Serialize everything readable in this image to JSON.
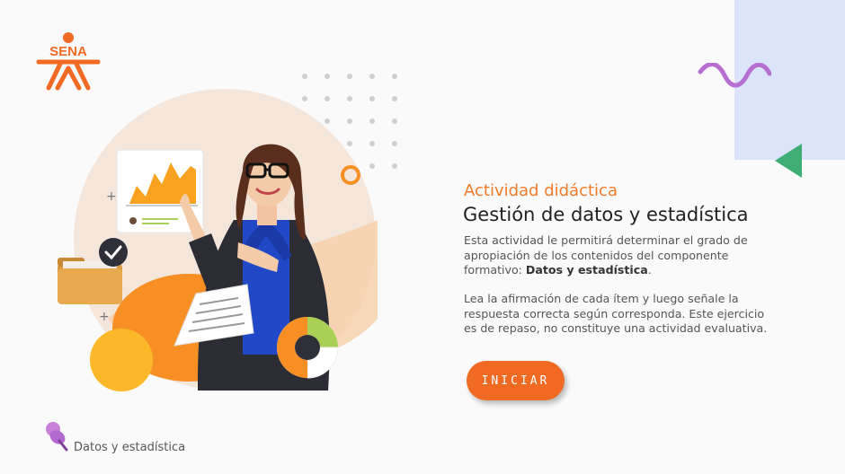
{
  "logo": {
    "text": "SENA"
  },
  "intro": {
    "eyebrow": "Actividad didáctica",
    "title": "Gestión de datos y estadística",
    "p1_text": "Esta actividad le permitirá determinar el grado de apropiación de los contenidos del componente formativo: ",
    "p1_bold": "Datos y estadística",
    "p1_end": ".",
    "p2_text": "Lea la afirmación de cada ítem y luego señale la respuesta correcta según corresponda.  Este ejercicio es de repaso, no constituye una actividad evaluativa."
  },
  "start_button": {
    "label": "INICIAR"
  },
  "footer": {
    "label": "Datos y estadística",
    "icon": "pushpin-icon"
  },
  "colors": {
    "accent": "#f06a24",
    "eyebrow": "#f07c2a",
    "panel": "#dbe4fb",
    "wave": "#b66fd0",
    "triangle": "#3fae74"
  }
}
